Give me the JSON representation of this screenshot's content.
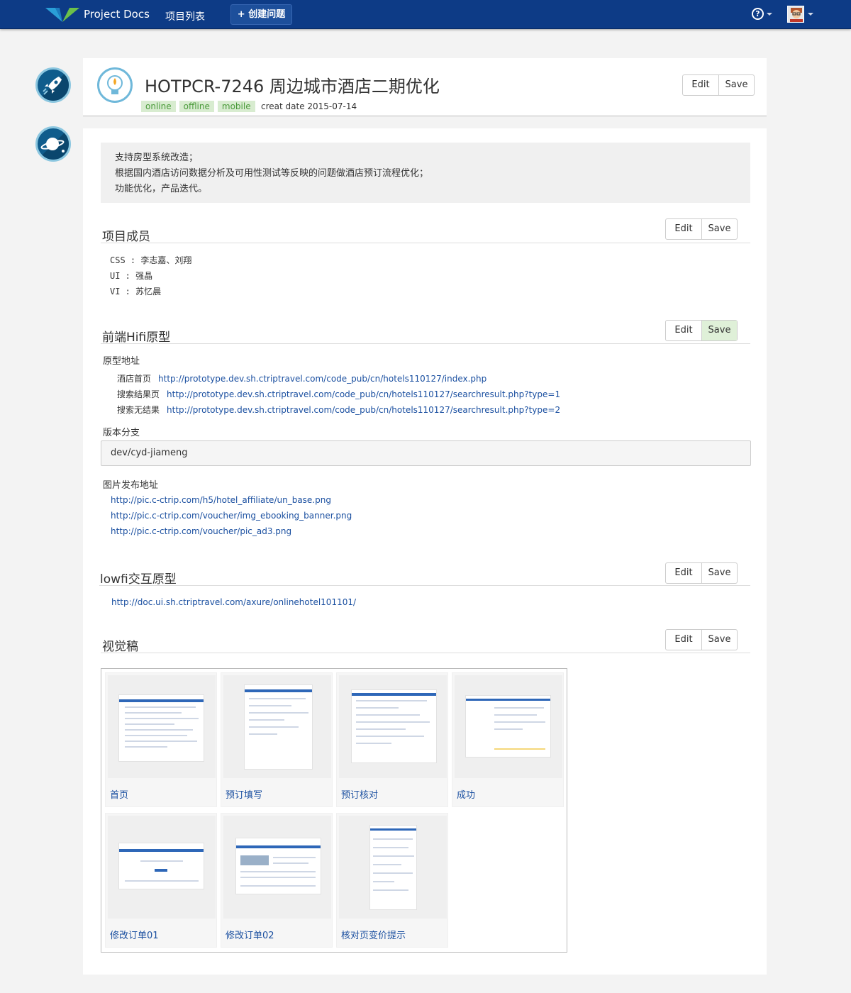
{
  "nav": {
    "brand": "Project Docs",
    "project_list": "项目列表",
    "create_issue": "+ 创建问题",
    "help_glyph": "?"
  },
  "issue": {
    "title": "HOTPCR-7246 周边城市酒店二期优化",
    "tags": [
      "online",
      "offline",
      "mobile"
    ],
    "create_date": "creat date 2015-07-14",
    "edit_label": "Edit",
    "save_label": "Save"
  },
  "description": [
    "支持房型系统改造；",
    "根据国内酒店访问数据分析及可用性测试等反映的问题做酒店预订流程优化；",
    "功能优化，产品迭代。"
  ],
  "members": {
    "title": "项目成员",
    "rows": [
      "CSS : 李志嘉、刘翔",
      "UI : 强晶",
      "VI : 苏忆晨"
    ]
  },
  "hifi": {
    "title": "前端Hifi原型",
    "proto_label": "原型地址",
    "prototypes": [
      {
        "name": "酒店首页",
        "url": "http://prototype.dev.sh.ctriptravel.com/code_pub/cn/hotels110127/index.php"
      },
      {
        "name": "搜索结果页",
        "url": "http://prototype.dev.sh.ctriptravel.com/code_pub/cn/hotels110127/searchresult.php?type=1"
      },
      {
        "name": "搜索无结果",
        "url": "http://prototype.dev.sh.ctriptravel.com/code_pub/cn/hotels110127/searchresult.php?type=2"
      }
    ],
    "branch_label": "版本分支",
    "branch_value": "dev/cyd-jiameng",
    "image_label": "图片发布地址",
    "images": [
      "http://pic.c-ctrip.com/h5/hotel_affiliate/un_base.png",
      "http://pic.c-ctrip.com/voucher/img_ebooking_banner.png",
      "http://pic.c-ctrip.com/voucher/pic_ad3.png"
    ]
  },
  "lowfi": {
    "title": "lowfi交互原型",
    "url": "http://doc.ui.sh.ctriptravel.com/axure/onlinehotel101101/"
  },
  "visual": {
    "title": "视觉稿",
    "cards": [
      "首页",
      "预订填写",
      "预订核对",
      "成功",
      "修改订单01",
      "修改订单02",
      "核对页变价提示"
    ]
  },
  "colors": {
    "navbar": "#0d3b86",
    "link": "#1a4fa0",
    "tag_bg": "#d8ecd0",
    "tag_text": "#4a9a3a",
    "save_active": "#dff0d8"
  },
  "icons": {
    "side_top": "rocket-icon",
    "side_bottom": "planet-icon",
    "issue": "lightbulb-icon",
    "help": "help-circle-icon",
    "avatar": "user-avatar"
  }
}
